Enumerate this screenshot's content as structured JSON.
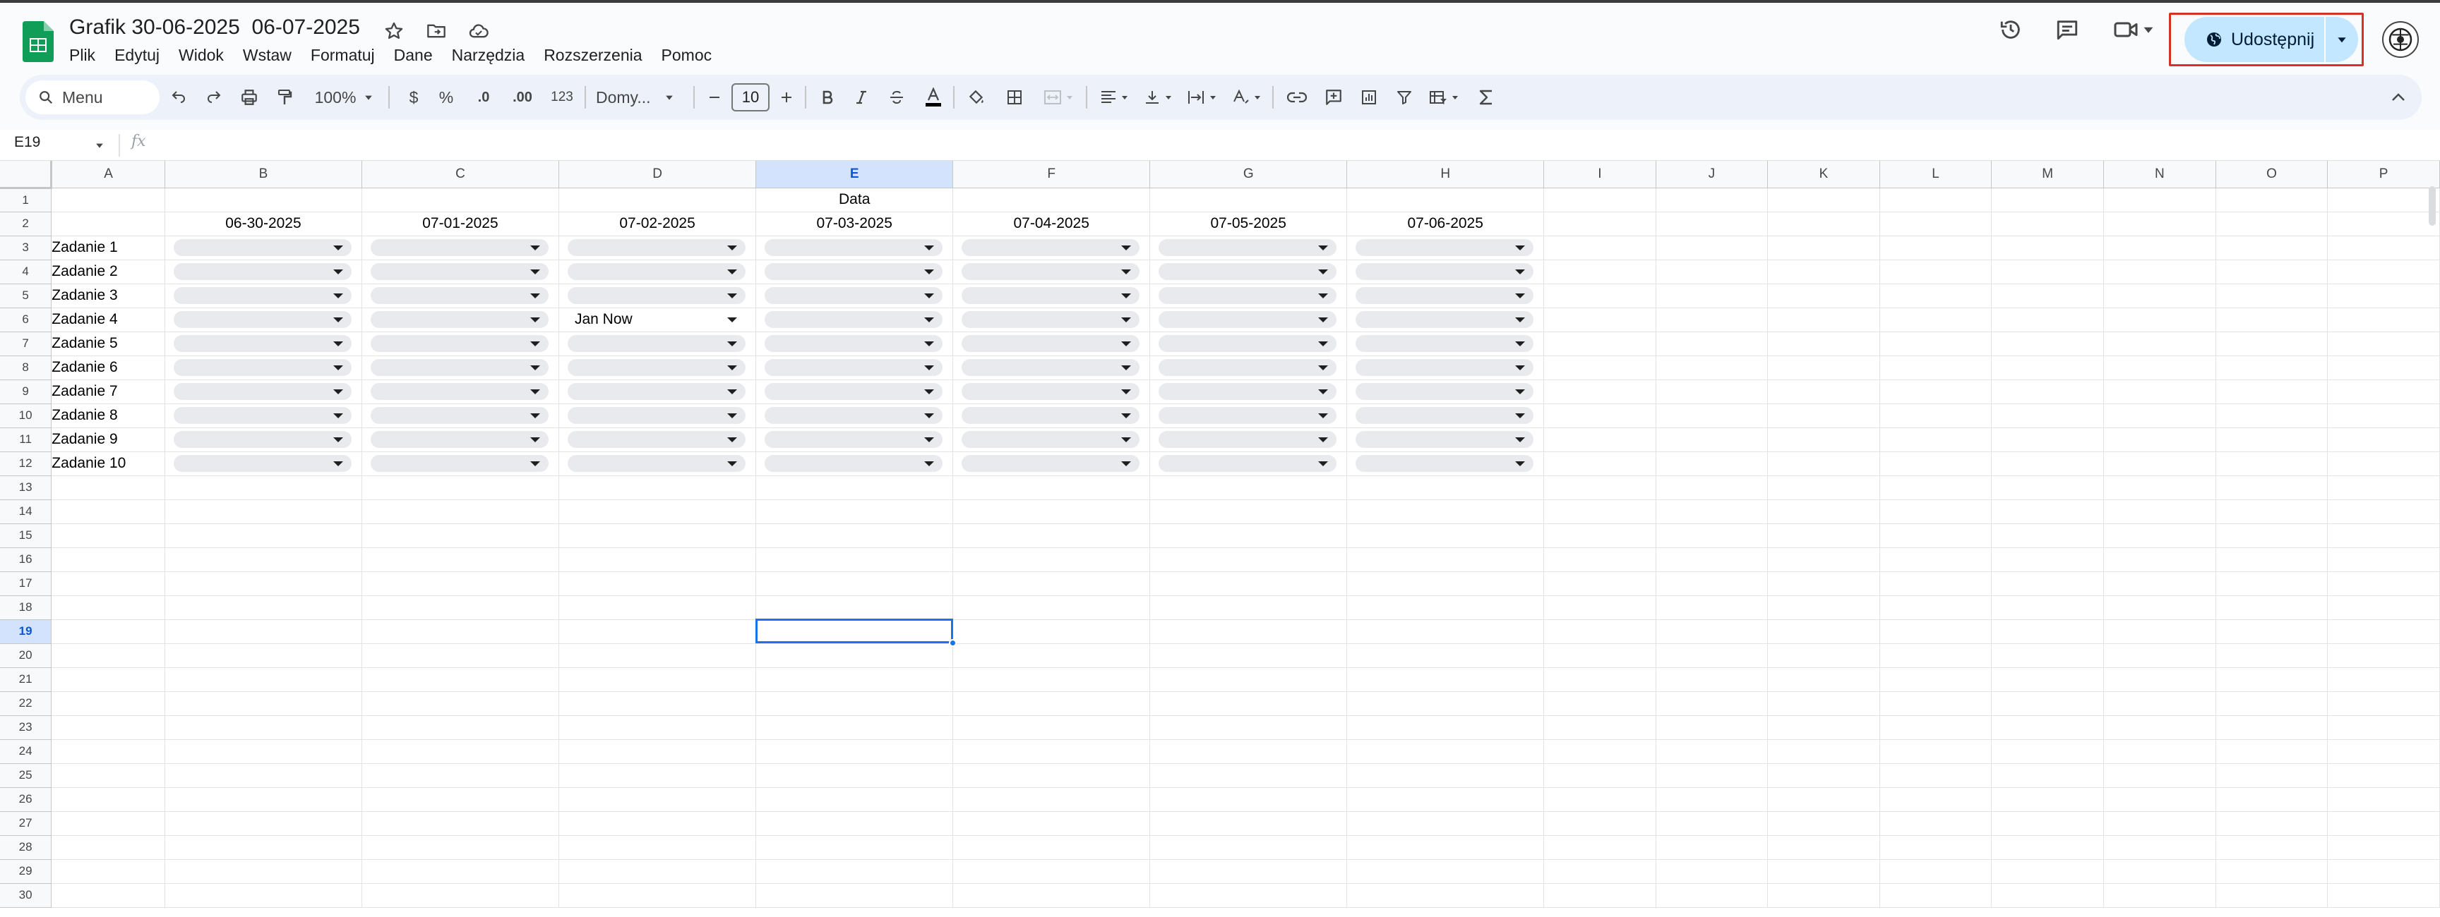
{
  "header": {
    "title": "Grafik 30-06-2025  06-07-2025",
    "menu": [
      "Plik",
      "Edytuj",
      "Widok",
      "Wstaw",
      "Formatuj",
      "Dane",
      "Narzędzia",
      "Rozszerzenia",
      "Pomoc"
    ],
    "share_label": "Udostępnij"
  },
  "toolbar": {
    "search_label": "Menu",
    "zoom": "100%",
    "currency": "$",
    "percent": "%",
    "dec_decrease": ".0",
    "dec_increase": ".00",
    "number_format": "123",
    "font": "Domy...",
    "font_size": "10"
  },
  "formula_bar": {
    "cell_ref": "E19",
    "fx": "fx"
  },
  "sheet": {
    "columns": [
      "A",
      "B",
      "C",
      "D",
      "E",
      "F",
      "G",
      "H",
      "I",
      "J",
      "K",
      "L",
      "M",
      "N",
      "O",
      "P"
    ],
    "selected_column": "E",
    "selected_row": 19,
    "data_header": "Data",
    "dates": [
      "06-30-2025",
      "07-01-2025",
      "07-02-2025",
      "07-03-2025",
      "07-04-2025",
      "07-05-2025",
      "07-06-2025"
    ],
    "tasks": [
      "Zadanie 1",
      "Zadanie 2",
      "Zadanie 3",
      "Zadanie 4",
      "Zadanie 5",
      "Zadanie 6",
      "Zadanie 7",
      "Zadanie 8",
      "Zadanie 9",
      "Zadanie 10"
    ],
    "filled_value": "Jan Now",
    "row_count": 30
  }
}
